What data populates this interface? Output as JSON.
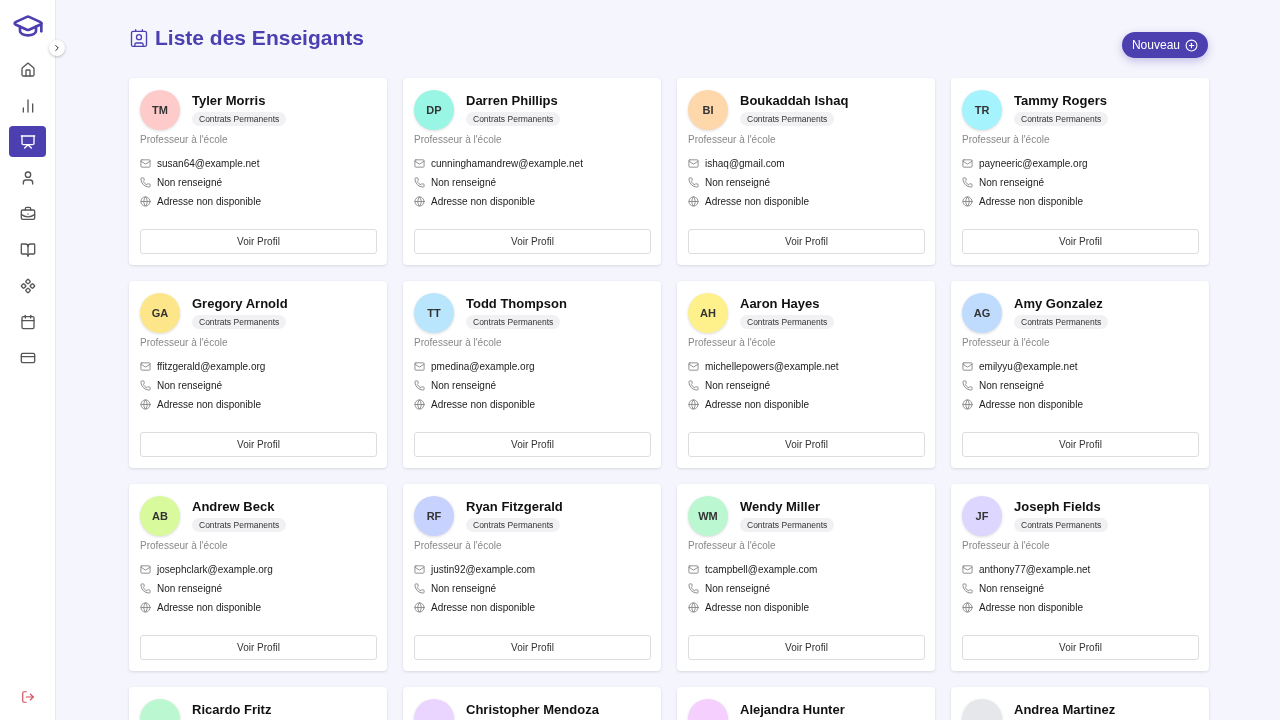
{
  "sidebar": {
    "items": [
      {
        "selected": false
      },
      {
        "selected": false
      },
      {
        "selected": true
      },
      {
        "selected": false
      },
      {
        "selected": false
      },
      {
        "selected": false
      },
      {
        "selected": false
      },
      {
        "selected": false
      },
      {
        "selected": false
      }
    ]
  },
  "header": {
    "title": "Liste des Enseigants",
    "button": "Nouveau"
  },
  "teachers": [
    {
      "initials": "TM",
      "color": "#fecaca",
      "name": "Tyler Morris",
      "badge": "Contrats Permanents",
      "role": "Professeur à l'école",
      "email": "susan64@example.net",
      "phone": "Non renseigné",
      "address": "Adresse non disponible",
      "button": "Voir Profil"
    },
    {
      "initials": "DP",
      "color": "#99f6e4",
      "name": "Darren Phillips",
      "badge": "Contrats Permanents",
      "role": "Professeur à l'école",
      "email": "cunninghamandrew@example.net",
      "phone": "Non renseigné",
      "address": "Adresse non disponible",
      "button": "Voir Profil"
    },
    {
      "initials": "BI",
      "color": "#fed7aa",
      "name": "Boukaddah Ishaq",
      "badge": "Contrats Permanents",
      "role": "Professeur à l'école",
      "email": "ishaq@gmail.com",
      "phone": "Non renseigné",
      "address": "Adresse non disponible",
      "button": "Voir Profil"
    },
    {
      "initials": "TR",
      "color": "#a5f3fc",
      "name": "Tammy Rogers",
      "badge": "Contrats Permanents",
      "role": "Professeur à l'école",
      "email": "payneeric@example.org",
      "phone": "Non renseigné",
      "address": "Adresse non disponible",
      "button": "Voir Profil"
    },
    {
      "initials": "GA",
      "color": "#fde68a",
      "name": "Gregory Arnold",
      "badge": "Contrats Permanents",
      "role": "Professeur à l'école",
      "email": "ffitzgerald@example.org",
      "phone": "Non renseigné",
      "address": "Adresse non disponible",
      "button": "Voir Profil"
    },
    {
      "initials": "TT",
      "color": "#bae6fd",
      "name": "Todd Thompson",
      "badge": "Contrats Permanents",
      "role": "Professeur à l'école",
      "email": "pmedina@example.org",
      "phone": "Non renseigné",
      "address": "Adresse non disponible",
      "button": "Voir Profil"
    },
    {
      "initials": "AH",
      "color": "#fef08a",
      "name": "Aaron Hayes",
      "badge": "Contrats Permanents",
      "role": "Professeur à l'école",
      "email": "michellepowers@example.net",
      "phone": "Non renseigné",
      "address": "Adresse non disponible",
      "button": "Voir Profil"
    },
    {
      "initials": "AG",
      "color": "#bfdbfe",
      "name": "Amy Gonzalez",
      "badge": "Contrats Permanents",
      "role": "Professeur à l'école",
      "email": "emilyyu@example.net",
      "phone": "Non renseigné",
      "address": "Adresse non disponible",
      "button": "Voir Profil"
    },
    {
      "initials": "AB",
      "color": "#d9f99d",
      "name": "Andrew Beck",
      "badge": "Contrats Permanents",
      "role": "Professeur à l'école",
      "email": "josephclark@example.org",
      "phone": "Non renseigné",
      "address": "Adresse non disponible",
      "button": "Voir Profil"
    },
    {
      "initials": "RF",
      "color": "#c7d2fe",
      "name": "Ryan Fitzgerald",
      "badge": "Contrats Permanents",
      "role": "Professeur à l'école",
      "email": "justin92@example.com",
      "phone": "Non renseigné",
      "address": "Adresse non disponible",
      "button": "Voir Profil"
    },
    {
      "initials": "WM",
      "color": "#bbf7d0",
      "name": "Wendy Miller",
      "badge": "Contrats Permanents",
      "role": "Professeur à l'école",
      "email": "tcampbell@example.com",
      "phone": "Non renseigné",
      "address": "Adresse non disponible",
      "button": "Voir Profil"
    },
    {
      "initials": "JF",
      "color": "#ddd6fe",
      "name": "Joseph Fields",
      "badge": "Contrats Permanents",
      "role": "Professeur à l'école",
      "email": "anthony77@example.net",
      "phone": "Non renseigné",
      "address": "Adresse non disponible",
      "button": "Voir Profil"
    },
    {
      "color": "#bbf7d0",
      "name": "Ricardo Fritz"
    },
    {
      "color": "#e9d5ff",
      "name": "Christopher Mendoza"
    },
    {
      "color": "#f5d0fe",
      "name": "Alejandra Hunter"
    },
    {
      "color": "#e5e7eb",
      "name": "Andrea Martinez"
    }
  ]
}
